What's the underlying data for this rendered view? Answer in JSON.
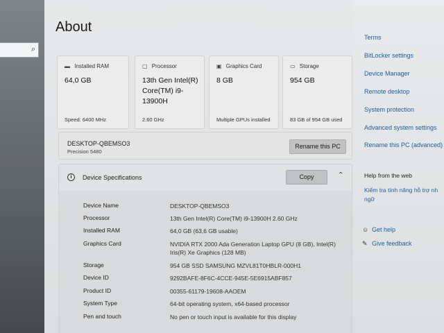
{
  "page": {
    "title": "About"
  },
  "search": {
    "icon": "search-icon"
  },
  "cards": [
    {
      "icon": "ram-icon",
      "header": "Installed RAM",
      "value": "64,0 GB",
      "sub": "Speed: 6400 MHz"
    },
    {
      "icon": "processor-icon",
      "header": "Processor",
      "value": "13th Gen Intel(R) Core(TM) i9-13900H",
      "sub": "2.60 GHz"
    },
    {
      "icon": "graphics-card-icon",
      "header": "Graphics Card",
      "value": "8 GB",
      "sub": "Multiple GPUs installed"
    },
    {
      "icon": "storage-icon",
      "header": "Storage",
      "value": "954 GB",
      "sub": "83 GB of 954 GB used"
    }
  ],
  "device": {
    "name": "DESKTOP-QBEMSO3",
    "model": "Precision 5480",
    "rename_label": "Rename this PC"
  },
  "specs": {
    "title": "Device Specifications",
    "copy_label": "Copy",
    "rows": [
      {
        "key": "Device Name",
        "value": "DESKTOP-QBEMSO3"
      },
      {
        "key": "Processor",
        "value": "13th Gen Intel(R) Core(TM) i9-13900H   2.60 GHz"
      },
      {
        "key": "Installed RAM",
        "value": "64,0 GB (63,6 GB usable)"
      },
      {
        "key": "Graphics Card",
        "value": "NVIDIA RTX 2000 Ada Generation Laptop GPU (8 GB), Intel(R) Iris(R) Xe Graphics (128 MB)"
      },
      {
        "key": "Storage",
        "value": "954 GB SSD SAMSUNG MZVL81T0HBLR-000H1"
      },
      {
        "key": "Device ID",
        "value": "9292BAFE-8F6C-4CCE-945E-5E6915ABF857"
      },
      {
        "key": "Product ID",
        "value": "00355-61179-19608-AAOEM"
      },
      {
        "key": "System Type",
        "value": "64-bit operating system, x64-based processor"
      },
      {
        "key": "Pen and touch",
        "value": "No pen or touch input is available for this display"
      }
    ]
  },
  "related": {
    "links": [
      "Terms",
      "BitLocker settings",
      "Device Manager",
      "Remote desktop",
      "System protection",
      "Advanced system settings",
      "Rename this PC (advanced)"
    ],
    "help_web_title": "Help from the web",
    "help_web_link": "Kiểm tra tính năng hỗ trợ nh ngữ",
    "get_help": "Get help",
    "give_feedback": "Give feedback"
  },
  "colors": {
    "link": "#1f5fa6",
    "button": "#bfc1c2"
  }
}
